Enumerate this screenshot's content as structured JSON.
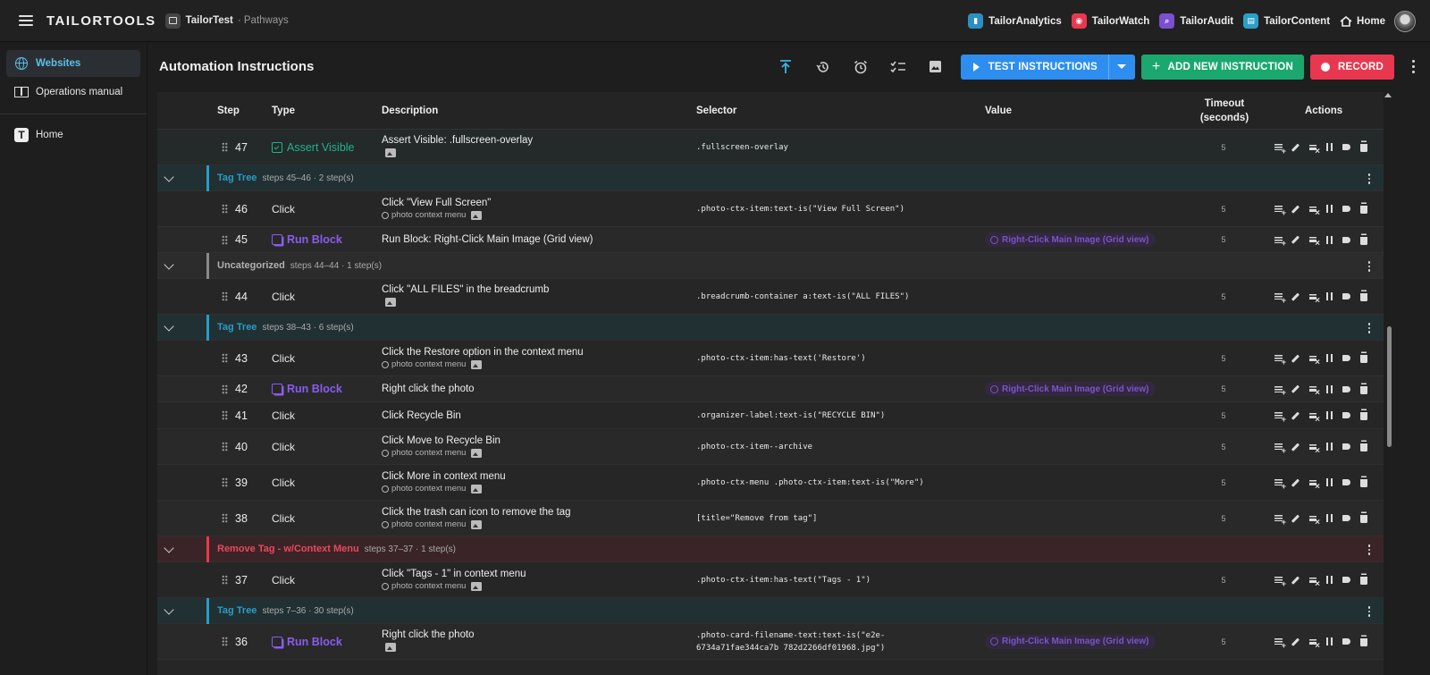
{
  "topbar": {
    "brand": "TAILORTOOLS",
    "crumb_main": "TailorTest",
    "crumb_sub": "· Pathways",
    "apps": [
      {
        "label": "TailorAnalytics",
        "color": "#2b8fc2",
        "icon": "analytics-icon"
      },
      {
        "label": "TailorWatch",
        "color": "#e8384f",
        "icon": "watch-icon"
      },
      {
        "label": "TailorAudit",
        "color": "#7b4fd0",
        "icon": "audit-icon"
      },
      {
        "label": "TailorContent",
        "color": "#2b9fc7",
        "icon": "content-icon"
      }
    ],
    "home_label": "Home"
  },
  "sidebar": {
    "items": [
      {
        "label": "Websites",
        "icon": "globe-icon",
        "active": true
      },
      {
        "label": "Operations manual",
        "icon": "book-icon",
        "active": false
      },
      {
        "label": "Home",
        "icon": "tailortools-logo-icon",
        "active": false
      }
    ]
  },
  "main": {
    "title": "Automation Instructions",
    "tools": [
      "scroll-top-icon",
      "history-icon",
      "alarm-icon",
      "checklist-icon",
      "image-icon"
    ],
    "test_button": "TEST INSTRUCTIONS",
    "add_button": "ADD NEW INSTRUCTION",
    "record_button": "RECORD"
  },
  "colors": {
    "accent": "#2d8ef0",
    "green": "#1aa86f",
    "red": "#e8384f",
    "teal_group": "#2a9cc5",
    "runblock": "#8a5cf0",
    "assert": "#22b38a"
  },
  "table": {
    "headers": {
      "step": "Step",
      "type": "Type",
      "description": "Description",
      "selector": "Selector",
      "value": "Value",
      "timeout_l1": "Timeout",
      "timeout_l2": "(seconds)",
      "actions": "Actions"
    },
    "context_label": "photo context menu",
    "r47": {
      "step": "47",
      "type": "Assert Visible",
      "desc": "Assert Visible: .fullscreen-overlay",
      "selector": ".fullscreen-overlay",
      "timeout": "5"
    },
    "g1": {
      "name": "Tag Tree",
      "meta": "steps 45–46 · 2 step(s)"
    },
    "r46": {
      "step": "46",
      "type": "Click",
      "desc": "Click \"View Full Screen\"",
      "selector": ".photo-ctx-item:text-is(\"View Full Screen\")",
      "timeout": "5"
    },
    "r45": {
      "step": "45",
      "type": "Run Block",
      "desc": "Run Block: Right-Click Main Image (Grid view)",
      "value": "Right-Click Main Image (Grid view)",
      "timeout": "5"
    },
    "g2": {
      "name": "Uncategorized",
      "meta": "steps 44–44 · 1 step(s)"
    },
    "r44": {
      "step": "44",
      "type": "Click",
      "desc": "Click \"ALL FILES\" in the breadcrumb",
      "selector": ".breadcrumb-container a:text-is(\"ALL FILES\")",
      "timeout": "5"
    },
    "g3": {
      "name": "Tag Tree",
      "meta": "steps 38–43 · 6 step(s)"
    },
    "r43": {
      "step": "43",
      "type": "Click",
      "desc": "Click the Restore option in the context menu",
      "selector": ".photo-ctx-item:has-text('Restore')",
      "timeout": "5"
    },
    "r42": {
      "step": "42",
      "type": "Run Block",
      "desc": "Right click the photo",
      "value": "Right-Click Main Image (Grid view)",
      "timeout": "5"
    },
    "r41": {
      "step": "41",
      "type": "Click",
      "desc": "Click Recycle Bin",
      "selector": ".organizer-label:text-is(\"RECYCLE BIN\")",
      "timeout": "5"
    },
    "r40": {
      "step": "40",
      "type": "Click",
      "desc": "Click Move to Recycle Bin",
      "selector": ".photo-ctx-item--archive",
      "timeout": "5"
    },
    "r39": {
      "step": "39",
      "type": "Click",
      "desc": "Click More in context menu",
      "selector": ".photo-ctx-menu .photo-ctx-item:text-is(\"More\")",
      "timeout": "5"
    },
    "r38": {
      "step": "38",
      "type": "Click",
      "desc": "Click the trash can icon to remove the tag",
      "selector": "[title=\"Remove from tag\"]",
      "timeout": "5"
    },
    "g4": {
      "name": "Remove Tag - w/Context Menu",
      "meta": "steps 37–37 · 1 step(s)"
    },
    "r37": {
      "step": "37",
      "type": "Click",
      "desc": "Click \"Tags - 1\" in context menu",
      "selector": ".photo-ctx-item:has-text(\"Tags - 1\")",
      "timeout": "5"
    },
    "g5": {
      "name": "Tag Tree",
      "meta": "steps 7–36 · 30 step(s)"
    },
    "r36": {
      "step": "36",
      "type": "Run Block",
      "desc": "Right click the photo",
      "selector": ".photo-card-filename-text:text-is(\"e2e-6734a71fae344ca7b 782d2266df01968.jpg\")",
      "value": "Right-Click Main Image (Grid view)",
      "timeout": "5"
    }
  }
}
